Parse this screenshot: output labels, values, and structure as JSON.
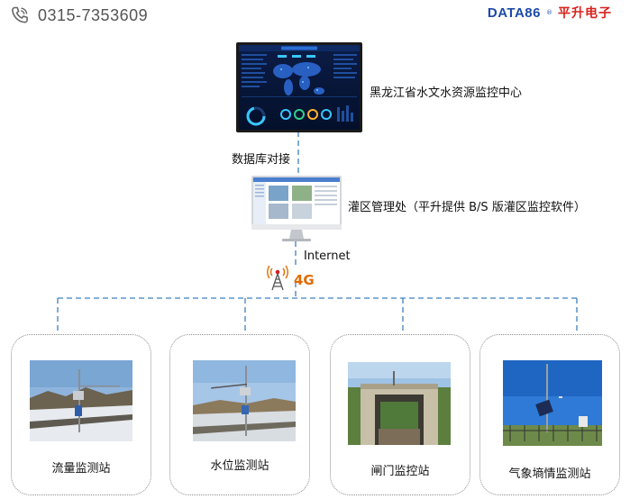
{
  "header": {
    "phone": "0315-7353609",
    "brand_en": "DATA86",
    "brand_cn": "平升电子"
  },
  "center": {
    "name": "黑龙江省水文水资源监控中心",
    "dashboard_colors": {
      "bg": "#06122e",
      "map": "#2a63c9",
      "accent": "#38c6ff"
    }
  },
  "link_top": "数据库对接",
  "office": {
    "name": "灌区管理处（平升提供 B/S 版灌区监控软件）"
  },
  "link_internet": "Internet",
  "network": {
    "label": "4G",
    "icon": "radio-tower-icon",
    "color": "#e26a00"
  },
  "colors": {
    "line": "#3e7fc0",
    "card_border": "#8e8e8e"
  },
  "stations": [
    {
      "name": "流量监测站",
      "icon": "flow-station-photo"
    },
    {
      "name": "水位监测站",
      "icon": "water-level-station-photo"
    },
    {
      "name": "闸门监控站",
      "icon": "gate-station-photo"
    },
    {
      "name": "气象墒情监测站",
      "icon": "weather-soil-station-photo"
    }
  ]
}
